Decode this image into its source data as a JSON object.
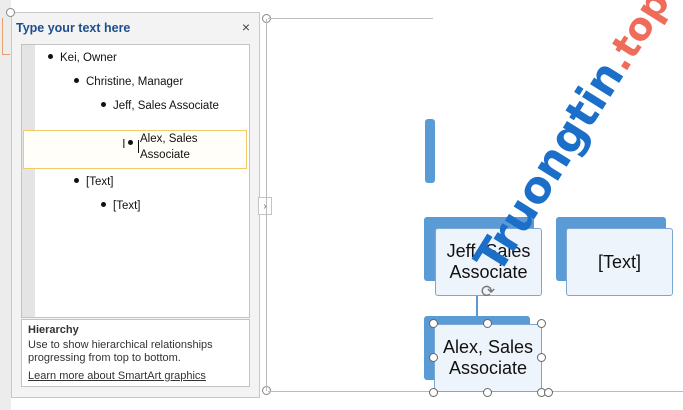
{
  "pane": {
    "title": "Type your text here",
    "close_glyph": "×",
    "bullets": [
      {
        "level": 1,
        "text": "Kei, Owner"
      },
      {
        "level": 2,
        "text": "Christine, Manager"
      },
      {
        "level": 3,
        "text": "Jeff, Sales Associate"
      },
      {
        "level": 4,
        "text_line1": "Alex, Sales",
        "text_line2": "Associate"
      },
      {
        "level": 2,
        "text": "[Text]"
      },
      {
        "level": 3,
        "text": "[Text]"
      }
    ],
    "description": {
      "title": "Hierarchy",
      "body": "Use to show hierarchical relationships progressing from top to bottom.",
      "link": "Learn more about SmartArt graphics"
    },
    "collapse_glyph": "›"
  },
  "diagram": {
    "card_jeff_line1": "Jeff, Sales",
    "card_jeff_line2": "Associate",
    "card_text": "[Text]",
    "card_alex_line1": "Alex, Sales",
    "card_alex_line2": "Associate",
    "rotate_glyph": "⟳"
  },
  "watermark": {
    "main": "Truongtin",
    "sub": ".top"
  },
  "colors": {
    "accent_blue": "#5b9bd5",
    "title_blue": "#1f4e8c",
    "highlight_border": "#f2c96b",
    "watermark_blue": "#1b6fc8",
    "watermark_red": "#ef6b5a"
  }
}
